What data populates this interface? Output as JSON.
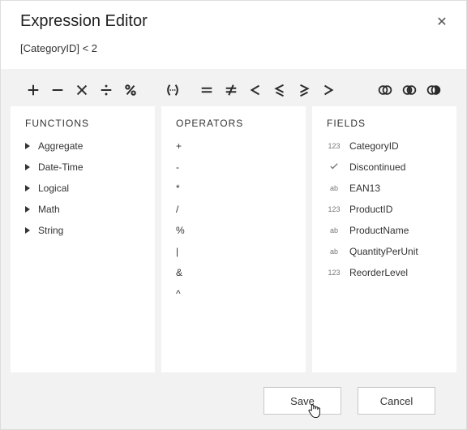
{
  "header": {
    "title": "Expression Editor",
    "close_glyph": "✕"
  },
  "expression": {
    "text": "[CategoryID] < 2"
  },
  "panels": {
    "functions": {
      "title": "FUNCTIONS",
      "items": [
        {
          "label": "Aggregate"
        },
        {
          "label": "Date-Time"
        },
        {
          "label": "Logical"
        },
        {
          "label": "Math"
        },
        {
          "label": "String"
        }
      ]
    },
    "operators": {
      "title": "OPERATORS",
      "items": [
        {
          "label": "+"
        },
        {
          "label": "-"
        },
        {
          "label": "*"
        },
        {
          "label": "/"
        },
        {
          "label": "%"
        },
        {
          "label": "|"
        },
        {
          "label": "&"
        },
        {
          "label": "^"
        }
      ]
    },
    "fields": {
      "title": "FIELDS",
      "items": [
        {
          "type": "num",
          "label": "CategoryID"
        },
        {
          "type": "bool",
          "label": "Discontinued"
        },
        {
          "type": "str",
          "label": "EAN13"
        },
        {
          "type": "num",
          "label": "ProductID"
        },
        {
          "type": "str",
          "label": "ProductName"
        },
        {
          "type": "str",
          "label": "QuantityPerUnit"
        },
        {
          "type": "num",
          "label": "ReorderLevel"
        }
      ],
      "type_glyphs": {
        "num": "123",
        "str": "ab"
      }
    }
  },
  "footer": {
    "save_label": "Save",
    "cancel_label": "Cancel"
  }
}
